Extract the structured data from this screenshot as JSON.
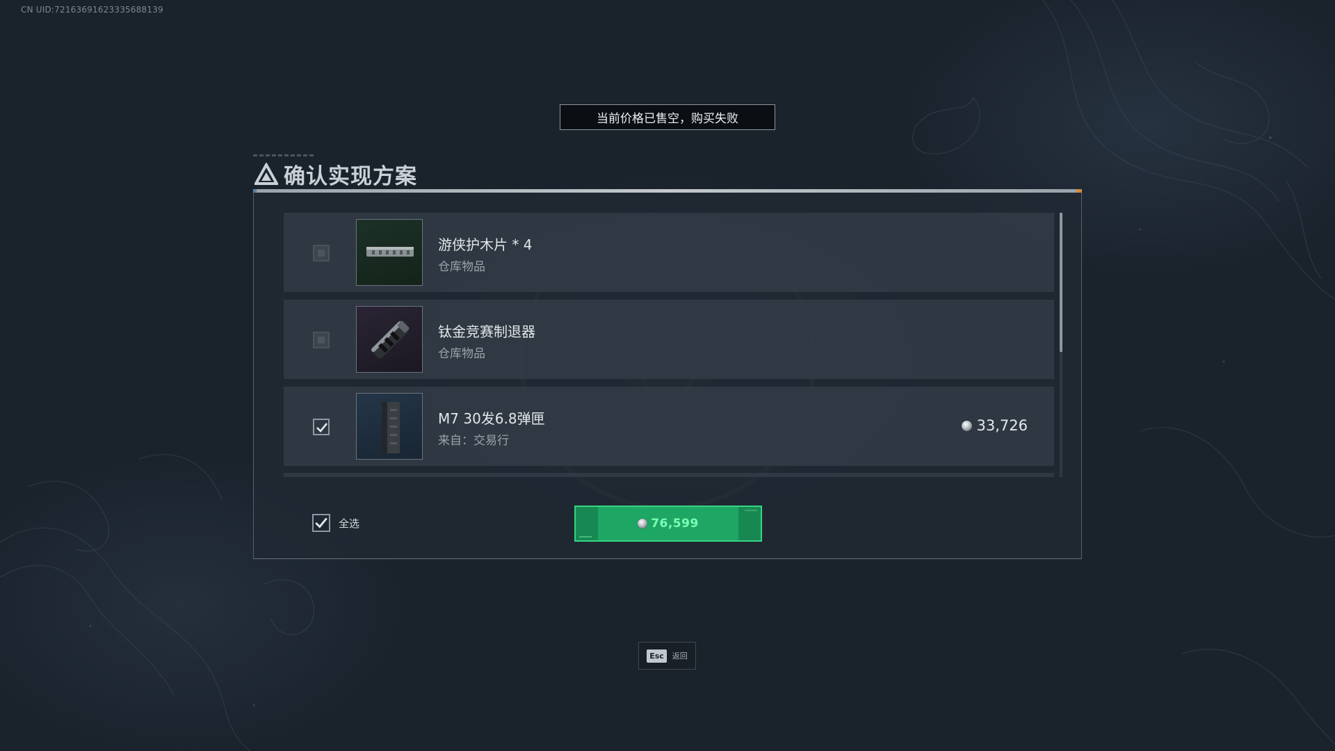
{
  "uid_text": "CN UID:72163691623335688139",
  "toast_message": "当前价格已售空，购买失败",
  "dialog": {
    "title": "确认实现方案",
    "items": [
      {
        "name": "游侠护木片 * 4",
        "source": "仓库物品",
        "checked": false,
        "price": "",
        "thumb_icon": "handguard-icon"
      },
      {
        "name": "钛金竞赛制退器",
        "source": "仓库物品",
        "checked": false,
        "price": "",
        "thumb_icon": "muzzle-brake-icon"
      },
      {
        "name": "M7 30发6.8弹匣",
        "source": "来自：交易行",
        "checked": true,
        "price": "33,726",
        "thumb_icon": "magazine-icon"
      }
    ],
    "select_all_label": "全选",
    "total_price": "76,599",
    "scroll_position": 0.0
  },
  "esc_hint": {
    "key": "Esc",
    "label": "返回"
  },
  "colors": {
    "accent_green": "#1ea664",
    "price_text_green": "#7dffb4",
    "background": "#1a222c"
  }
}
